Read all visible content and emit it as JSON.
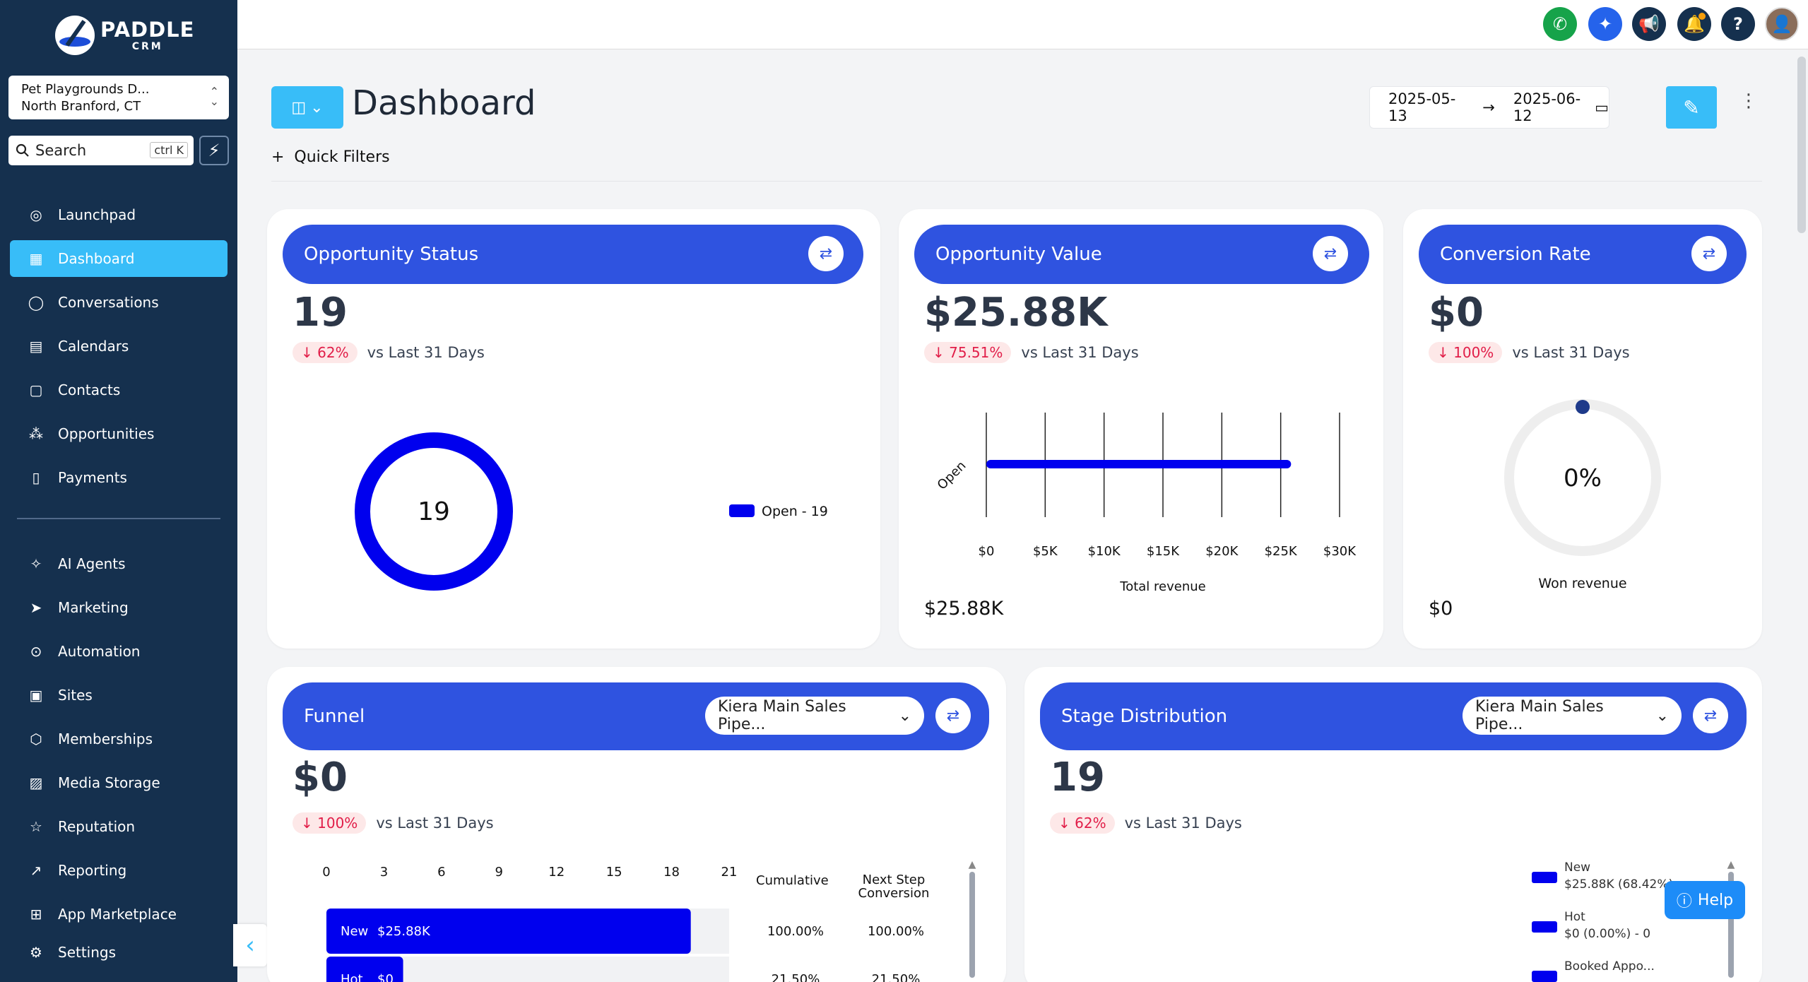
{
  "app": {
    "logo_line1": "PADDLE",
    "logo_line2": "CRM"
  },
  "location": {
    "name": "Pet Playgrounds D...",
    "address": "North Branford, CT"
  },
  "search": {
    "label": "Search",
    "shortcut": "ctrl K"
  },
  "nav": [
    {
      "label": "Launchpad",
      "icon": "rocket-icon"
    },
    {
      "label": "Dashboard",
      "icon": "grid-icon",
      "active": true
    },
    {
      "label": "Conversations",
      "icon": "chat-icon"
    },
    {
      "label": "Calendars",
      "icon": "calendar-icon"
    },
    {
      "label": "Contacts",
      "icon": "contacts-icon"
    },
    {
      "label": "Opportunities",
      "icon": "opportunities-icon"
    },
    {
      "label": "Payments",
      "icon": "payments-icon"
    },
    {
      "label": "AI Agents",
      "icon": "sparkle-icon"
    },
    {
      "label": "Marketing",
      "icon": "send-icon"
    },
    {
      "label": "Automation",
      "icon": "automation-icon"
    },
    {
      "label": "Sites",
      "icon": "sites-icon"
    },
    {
      "label": "Memberships",
      "icon": "badge-icon"
    },
    {
      "label": "Media Storage",
      "icon": "image-icon"
    },
    {
      "label": "Reputation",
      "icon": "star-icon"
    },
    {
      "label": "Reporting",
      "icon": "trend-icon"
    },
    {
      "label": "App Marketplace",
      "icon": "apps-icon"
    },
    {
      "label": "Settings",
      "icon": "gear-icon"
    }
  ],
  "header": {
    "title": "Dashboard",
    "quick_filters": "Quick Filters",
    "date_start": "2025-05-13",
    "date_end": "2025-06-12"
  },
  "colors": {
    "primary": "#2f53e0",
    "accent": "#38bdf8",
    "sidebar": "#15304e",
    "chart": "#0000ee"
  },
  "cards": {
    "status": {
      "title": "Opportunity Status",
      "value": "19",
      "delta": "62%",
      "compare": "vs Last 31 Days",
      "center": "19",
      "legend": "Open - 19"
    },
    "value": {
      "title": "Opportunity Value",
      "value": "$25.88K",
      "delta": "75.51%",
      "compare": "vs Last 31 Days",
      "footer": "$25.88K"
    },
    "conversion": {
      "title": "Conversion Rate",
      "value": "$0",
      "delta": "100%",
      "compare": "vs Last 31 Days",
      "center": "0%",
      "caption": "Won revenue",
      "footer": "$0"
    },
    "funnel": {
      "title": "Funnel",
      "pipeline": "Kiera Main Sales Pipe...",
      "value": "$0",
      "delta": "100%",
      "compare": "vs Last 31 Days",
      "col1": "Cumulative",
      "col2": "Next Step Conversion"
    },
    "stage": {
      "title": "Stage Distribution",
      "pipeline": "Kiera Main Sales Pipe...",
      "value": "19",
      "delta": "62%",
      "compare": "vs Last 31 Days"
    }
  },
  "help": {
    "label": "Help"
  },
  "chart_data": [
    {
      "type": "pie",
      "title": "Opportunity Status",
      "categories": [
        "Open"
      ],
      "values": [
        19
      ],
      "legend": "right"
    },
    {
      "type": "bar",
      "title": "Opportunity Value",
      "orientation": "horizontal",
      "categories": [
        "Open"
      ],
      "values": [
        25880
      ],
      "xlabel": "Total revenue",
      "xlim": [
        0,
        30000
      ],
      "xticks": [
        "$0",
        "$5K",
        "$10K",
        "$15K",
        "$20K",
        "$25K",
        "$30K"
      ],
      "grid": true
    },
    {
      "type": "pie",
      "title": "Conversion Rate",
      "categories": [
        "Won"
      ],
      "values": [
        0
      ],
      "center_label": "0%",
      "caption": "Won revenue"
    },
    {
      "type": "bar",
      "title": "Funnel",
      "orientation": "horizontal",
      "categories": [
        "New",
        "Hot"
      ],
      "values": [
        19,
        4
      ],
      "bar_labels": [
        "$25.88K",
        "$0"
      ],
      "xlim": [
        0,
        21
      ],
      "xticks": [
        "0",
        "3",
        "6",
        "9",
        "12",
        "15",
        "18",
        "21"
      ],
      "cumulative": [
        "100.00%",
        "21.50%"
      ],
      "next_step": [
        "100.00%",
        "21.50%"
      ]
    },
    {
      "type": "bar",
      "title": "Stage Distribution",
      "legend_entries": [
        {
          "name": "New",
          "detail": "$25.88K (68.42%)"
        },
        {
          "name": "Hot",
          "detail": "$0 (0.00%) - 0"
        },
        {
          "name": "Booked Appo...",
          "detail": ""
        }
      ]
    }
  ]
}
